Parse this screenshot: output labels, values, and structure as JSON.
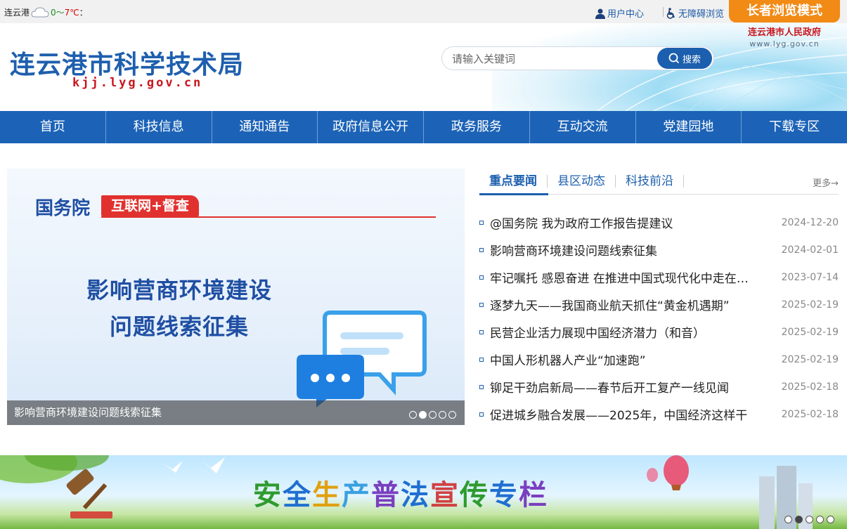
{
  "topbar": {
    "city": "连云港",
    "temp_low": "0～",
    "temp_high": "7℃",
    "temp_suffix": "：",
    "user_center": "用户中心",
    "accessible": "无障碍浏览",
    "elder_mode": "长者浏览模式"
  },
  "header": {
    "title": "连云港市科学技术局",
    "domain": "kjj.lyg.gov.cn",
    "search_placeholder": "请输入关键词",
    "search_button": "搜索",
    "gov_name": "连云港市人民政府",
    "gov_domain": "www.lyg.gov.cn"
  },
  "nav": [
    "首页",
    "科技信息",
    "通知通告",
    "政府信息公开",
    "政务服务",
    "互动交流",
    "党建园地",
    "下载专区"
  ],
  "slider": {
    "graphic_heading": "国务院",
    "graphic_tag": "互联网+督查",
    "graphic_line1": "影响营商环境建设",
    "graphic_line2": "问题线索征集",
    "caption": "影响营商环境建设问题线索征集",
    "dot_count": 5,
    "active_dot": 1
  },
  "news": {
    "tabs": [
      "重点要闻",
      "县区动态",
      "科技前沿"
    ],
    "active_tab": 0,
    "more": "更多→",
    "items": [
      {
        "title": "@国务院 我为政府工作报告提建议",
        "date": "2024-12-20"
      },
      {
        "title": "影响营商环境建设问题线索征集",
        "date": "2024-02-01"
      },
      {
        "title": "牢记嘱托 感恩奋进 在推进中国式现代化中走在前做示范",
        "date": "2023-07-14"
      },
      {
        "title": "逐梦九天——我国商业航天抓住“黄金机遇期”",
        "date": "2025-02-19"
      },
      {
        "title": "民营企业活力展现中国经济潜力（和音）",
        "date": "2025-02-19"
      },
      {
        "title": "中国人形机器人产业“加速跑”",
        "date": "2025-02-19"
      },
      {
        "title": "铆足干劲启新局——春节后开工复产一线见闻",
        "date": "2025-02-18"
      },
      {
        "title": "促进城乡融合发展——2025年，中国经济这样干",
        "date": "2025-02-18"
      }
    ]
  },
  "banner": {
    "text": "安全生产普法宣传专栏",
    "dot_count": 5,
    "active_dot": 1
  },
  "colors": {
    "brand_blue": "#1c63b7",
    "accent_orange": "#f28a16",
    "title_red": "#c8161e"
  }
}
